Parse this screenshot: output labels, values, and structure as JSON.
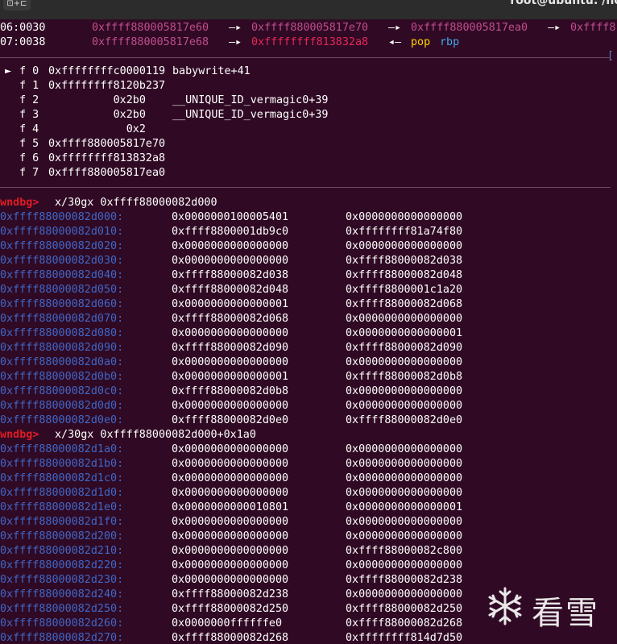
{
  "window": {
    "title": "root@ubuntu: /ho",
    "tab_button": "⊡+⊏"
  },
  "stack": {
    "rows": [
      {
        "offset": "06:0030",
        "addr": "0xffff880005817e60",
        "arrow1": "—▸",
        "v1": "0xffff880005817e70",
        "arrow2": "—▸",
        "v2": "0xffff880005817ea0",
        "arrow3": "—▸",
        "v3": "0xffff8"
      },
      {
        "offset": "07:0038",
        "addr": "0xffff880005817e68",
        "arrow1": "—▸",
        "v1": "0xffffffff813832a8",
        "arrow2": "◂—",
        "instr": "pop",
        "reg": "rbp"
      }
    ]
  },
  "backtrace": [
    {
      "marker": "►",
      "frame": "f 0",
      "addr": "0xffffffffc0000119",
      "sym": "babywrite+41"
    },
    {
      "marker": "",
      "frame": "f 1",
      "addr": "0xffffffff8120b237",
      "sym": ""
    },
    {
      "marker": "",
      "frame": "f 2",
      "addr": "          0x2b0",
      "sym": "__UNIQUE_ID_vermagic0+39"
    },
    {
      "marker": "",
      "frame": "f 3",
      "addr": "          0x2b0",
      "sym": "__UNIQUE_ID_vermagic0+39"
    },
    {
      "marker": "",
      "frame": "f 4",
      "addr": "            0x2",
      "sym": ""
    },
    {
      "marker": "",
      "frame": "f 5",
      "addr": "0xffff880005817e70",
      "sym": ""
    },
    {
      "marker": "",
      "frame": "f 6",
      "addr": "0xffffffff813832a8",
      "sym": ""
    },
    {
      "marker": "",
      "frame": "f 7",
      "addr": "0xffff880005817ea0",
      "sym": ""
    }
  ],
  "dump1": {
    "prompt": "pwndbg>",
    "command": "x/30gx 0xffff88000082d000",
    "rows": [
      [
        "0xffff88000082d000:",
        "0x0000000100005401",
        "0x0000000000000000"
      ],
      [
        "0xffff88000082d010:",
        "0xffff8800001db9c0",
        "0xffffffff81a74f80"
      ],
      [
        "0xffff88000082d020:",
        "0x0000000000000000",
        "0x0000000000000000"
      ],
      [
        "0xffff88000082d030:",
        "0x0000000000000000",
        "0xffff88000082d038"
      ],
      [
        "0xffff88000082d040:",
        "0xffff88000082d038",
        "0xffff88000082d048"
      ],
      [
        "0xffff88000082d050:",
        "0xffff88000082d048",
        "0xffff8800001c1a20"
      ],
      [
        "0xffff88000082d060:",
        "0x0000000000000001",
        "0xffff88000082d068"
      ],
      [
        "0xffff88000082d070:",
        "0xffff88000082d068",
        "0x0000000000000000"
      ],
      [
        "0xffff88000082d080:",
        "0x0000000000000000",
        "0x0000000000000001"
      ],
      [
        "0xffff88000082d090:",
        "0xffff88000082d090",
        "0xffff88000082d090"
      ],
      [
        "0xffff88000082d0a0:",
        "0x0000000000000000",
        "0x0000000000000000"
      ],
      [
        "0xffff88000082d0b0:",
        "0x0000000000000001",
        "0xffff88000082d0b8"
      ],
      [
        "0xffff88000082d0c0:",
        "0xffff88000082d0b8",
        "0x0000000000000000"
      ],
      [
        "0xffff88000082d0d0:",
        "0x0000000000000000",
        "0x0000000000000000"
      ],
      [
        "0xffff88000082d0e0:",
        "0xffff88000082d0e0",
        "0xffff88000082d0e0"
      ]
    ]
  },
  "dump2": {
    "prompt": "pwndbg>",
    "command": "x/30gx 0xffff88000082d000+0x1a0",
    "rows": [
      [
        "0xffff88000082d1a0:",
        "0x0000000000000000",
        "0x0000000000000000"
      ],
      [
        "0xffff88000082d1b0:",
        "0x0000000000000000",
        "0x0000000000000000"
      ],
      [
        "0xffff88000082d1c0:",
        "0x0000000000000000",
        "0x0000000000000000"
      ],
      [
        "0xffff88000082d1d0:",
        "0x0000000000000000",
        "0x0000000000000000"
      ],
      [
        "0xffff88000082d1e0:",
        "0x0000000000010801",
        "0x0000000000000001"
      ],
      [
        "0xffff88000082d1f0:",
        "0x0000000000000000",
        "0x0000000000000000"
      ],
      [
        "0xffff88000082d200:",
        "0x0000000000000000",
        "0x0000000000000000"
      ],
      [
        "0xffff88000082d210:",
        "0x0000000000000000",
        "0xffff88000082c800"
      ],
      [
        "0xffff88000082d220:",
        "0x0000000000000000",
        "0x0000000000000000"
      ],
      [
        "0xffff88000082d230:",
        "0x0000000000000000",
        "0xffff88000082d238"
      ],
      [
        "0xffff88000082d240:",
        "0xffff88000082d238",
        "0x0000000000000000"
      ],
      [
        "0xffff88000082d250:",
        "0xffff88000082d250",
        "0xffff88000082d250"
      ],
      [
        "0xffff88000082d260:",
        "0x0000000ffffffe0",
        "0xffff88000082d268"
      ],
      [
        "0xffff88000082d270:",
        "0xffff88000082d268",
        "0xffffffff814d7d50"
      ]
    ]
  },
  "watermark": {
    "text": "看雪",
    "icon": "snowflake-icon"
  },
  "colors": {
    "background": "#300a24",
    "stack_address": "#c04e8e",
    "code_address": "#e8265b",
    "instruction": "#ffd100",
    "register": "#3fa9e8",
    "heap_address": "#3f67c8",
    "prompt": "#e01b24"
  }
}
